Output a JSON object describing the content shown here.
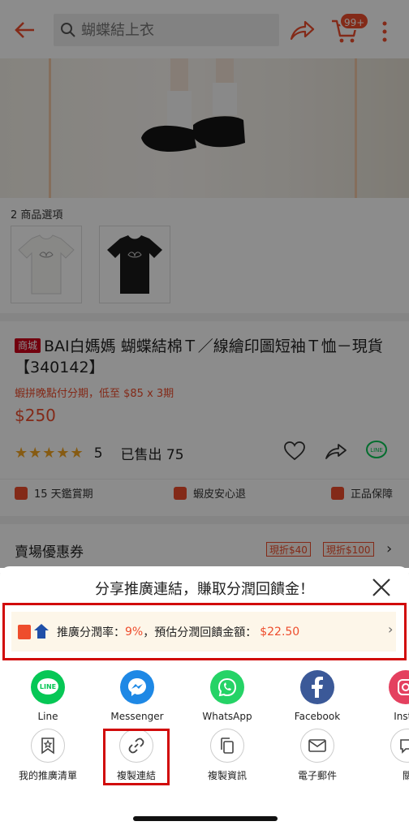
{
  "header": {
    "search_placeholder": "蝴蝶結上衣",
    "cart_badge": "99+"
  },
  "product": {
    "options_label": "2 商品選項",
    "mall_tag": "商城",
    "title": "BAI白媽媽 蝴蝶結棉Ｔ／線繪印圖短袖Ｔ恤－現貨【340142】",
    "installment": "蝦拼晚點付分期，低至 $85 x 3期",
    "price": "$250",
    "stars": "★★★★★",
    "rating": "5",
    "sold": "已售出 75",
    "guarantees": [
      "15 天鑑賞期",
      "蝦皮安心退",
      "正品保障"
    ]
  },
  "coupons": {
    "title": "賣場優惠券",
    "tags": [
      "現折$40",
      "現折$100"
    ]
  },
  "share_sheet": {
    "title": "分享推廣連結，賺取分潤回饋金！",
    "promo": {
      "text_before": "推廣分潤率：",
      "rate": "9%",
      "text_mid": "，預估分潤回饋金額：",
      "amount": "$22.50"
    },
    "apps": [
      {
        "label": "Line",
        "icon": "line-icon",
        "color": "#06c755"
      },
      {
        "label": "Messenger",
        "icon": "messenger-icon",
        "color": "#1e88e5"
      },
      {
        "label": "WhatsApp",
        "icon": "whatsapp-icon",
        "color": "#25d366"
      },
      {
        "label": "Facebook",
        "icon": "facebook-icon",
        "color": "#3b5998"
      },
      {
        "label": "Insta",
        "icon": "instagram-icon",
        "color": "#e4405f"
      }
    ],
    "actions": [
      {
        "label": "我的推廣清單",
        "icon": "bookmark-star-icon"
      },
      {
        "label": "複製連結",
        "icon": "link-icon"
      },
      {
        "label": "複製資訊",
        "icon": "copy-icon"
      },
      {
        "label": "電子郵件",
        "icon": "mail-icon"
      },
      {
        "label": "關",
        "icon": "chat-icon"
      }
    ]
  }
}
